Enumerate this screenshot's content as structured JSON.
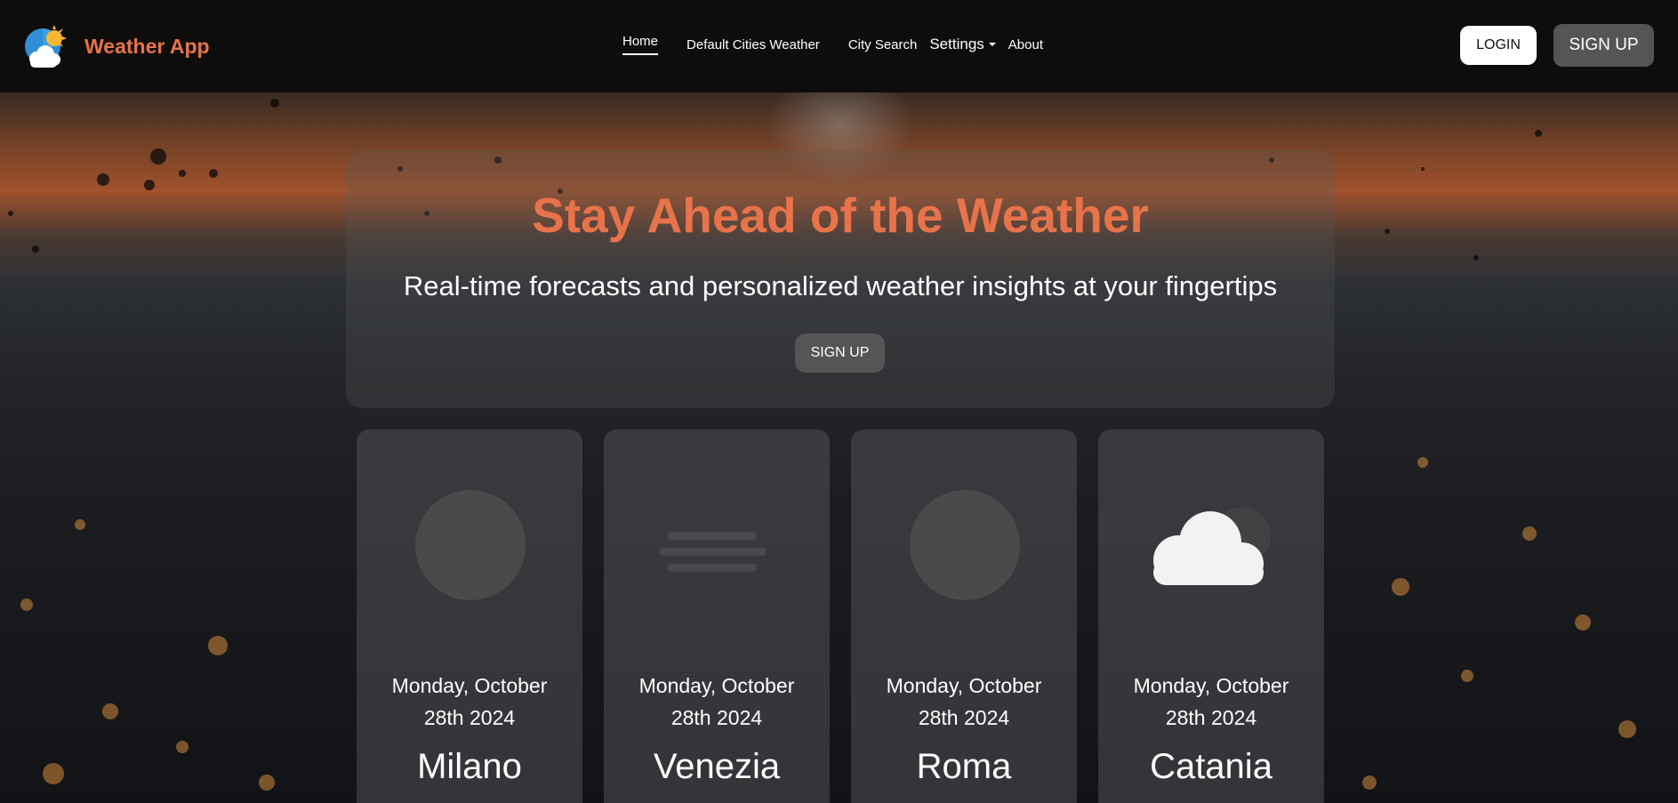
{
  "brand": {
    "name": "Weather App",
    "logo_icon": "sun-cloud-logo-icon"
  },
  "nav": {
    "home": "Home",
    "default_cities": "Default Cities Weather",
    "city_search": "City Search",
    "settings": "Settings",
    "about": "About"
  },
  "auth": {
    "login": "LOGIN",
    "signup": "SIGN UP"
  },
  "hero": {
    "title": "Stay Ahead of the Weather",
    "subtitle": "Real-time forecasts and personalized weather insights at your fingertips",
    "cta": "SIGN UP"
  },
  "cards": [
    {
      "date_line1": "Monday, October",
      "date_line2": "28th 2024",
      "city": "Milano",
      "icon": "loading-placeholder-icon"
    },
    {
      "date_line1": "Monday, October",
      "date_line2": "28th 2024",
      "city": "Venezia",
      "icon": "fog-icon"
    },
    {
      "date_line1": "Monday, October",
      "date_line2": "28th 2024",
      "city": "Roma",
      "icon": "loading-placeholder-icon"
    },
    {
      "date_line1": "Monday, October",
      "date_line2": "28th 2024",
      "city": "Catania",
      "icon": "cloud-icon"
    }
  ],
  "colors": {
    "accent": "#e8734a",
    "navbar": "#0f0d0c",
    "button_gray": "#555555"
  }
}
